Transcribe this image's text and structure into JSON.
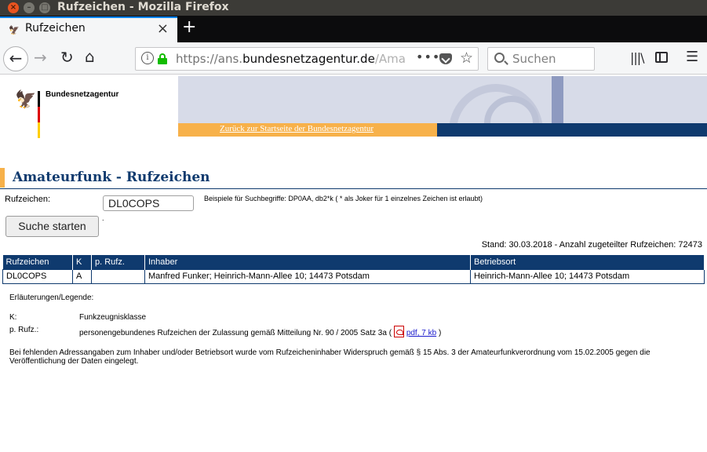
{
  "window": {
    "title": "Rufzeichen - Mozilla Firefox"
  },
  "tab": {
    "title": "Rufzeichen",
    "close": "×",
    "new_tab": "+"
  },
  "nav": {
    "url_prefix": "https://ans.",
    "url_host": "bundesnetzagentur.de",
    "url_tail": "/Ama",
    "more": "•••",
    "search_placeholder": "Suchen"
  },
  "header": {
    "brand": "Bundesnetzagentur",
    "back_link": "Zurück zur Startseite der Bundesnetzagentur"
  },
  "main": {
    "heading": "Amateurfunk - Rufzeichen",
    "callsign_label": "Rufzeichen:",
    "callsign_value": "DL0COPS",
    "examples": "Beispiele für Suchbegriffe: DP0AA, db2*k ( * als Joker für 1 einzelnes Zeichen ist erlaubt)",
    "search_button": "Suche starten",
    "dot": ".",
    "stand": "Stand: 30.03.2018 - Anzahl zugeteilter Rufzeichen: 72473"
  },
  "table": {
    "headers": [
      "Rufzeichen",
      "K",
      "p. Rufz.",
      "Inhaber",
      "Betriebsort"
    ],
    "rows": [
      [
        "DL0COPS",
        "A",
        "",
        "Manfred Funker; Heinrich-Mann-Allee 10; 14473 Potsdam",
        "Heinrich-Mann-Allee 10; 14473 Potsdam"
      ]
    ]
  },
  "legend": {
    "title": "Erläuterungen/Legende:",
    "k_key": "K:",
    "k_value": "Funkzeugnisklasse",
    "p_key": "p. Rufz.:",
    "p_value": "personengebundenes Rufzeichen der Zulassung gemäß Mitteilung Nr. 90 / 2005 Satz 3a (",
    "p_link": "pdf, 7 kb",
    "p_close": ")",
    "note": "Bei fehlenden Adressangaben zum Inhaber und/oder Betriebsort wurde vom Rufzeicheninhaber Widerspruch gemäß § 15 Abs. 3 der Amateurfunkverordnung vom 15.02.2005 gegen die Veröffentlichung der Daten eingelegt."
  },
  "colors": {
    "accent_blue": "#0f3a6e",
    "accent_orange": "#f7b14a",
    "firefox_blue": "#0a84ff"
  }
}
